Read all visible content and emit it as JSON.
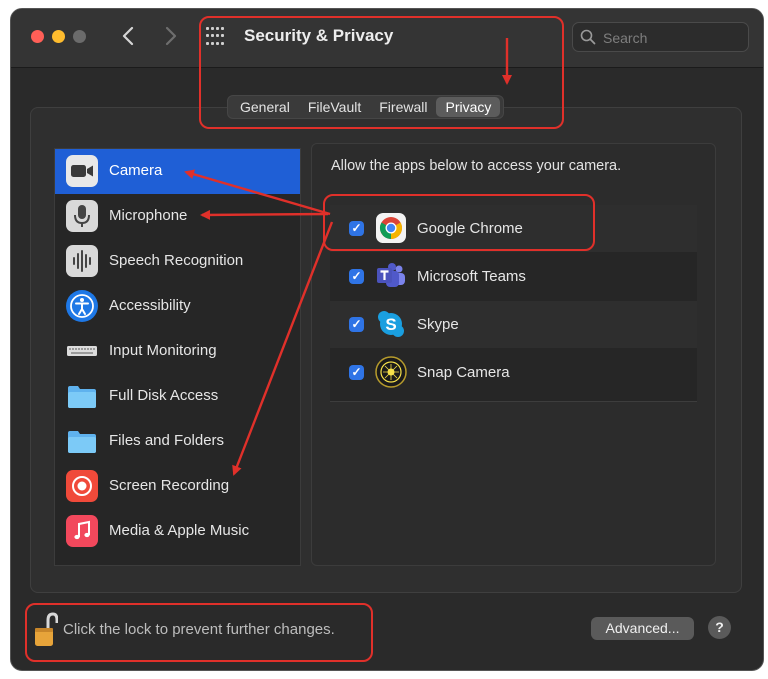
{
  "window": {
    "title": "Security & Privacy",
    "search": {
      "placeholder": "Search",
      "value": ""
    }
  },
  "tabs": [
    {
      "label": "General",
      "selected": false
    },
    {
      "label": "FileVault",
      "selected": false
    },
    {
      "label": "Firewall",
      "selected": false
    },
    {
      "label": "Privacy",
      "selected": true
    }
  ],
  "sidebar": {
    "items": [
      {
        "label": "Camera",
        "icon": "camera-icon",
        "selected": true
      },
      {
        "label": "Microphone",
        "icon": "microphone-icon",
        "selected": false
      },
      {
        "label": "Speech Recognition",
        "icon": "waveform-icon",
        "selected": false
      },
      {
        "label": "Accessibility",
        "icon": "accessibility-icon",
        "selected": false
      },
      {
        "label": "Input Monitoring",
        "icon": "keyboard-icon",
        "selected": false
      },
      {
        "label": "Full Disk Access",
        "icon": "folder-icon",
        "selected": false
      },
      {
        "label": "Files and Folders",
        "icon": "folder-icon",
        "selected": false
      },
      {
        "label": "Screen Recording",
        "icon": "record-icon",
        "selected": false
      },
      {
        "label": "Media & Apple Music",
        "icon": "music-note-icon",
        "selected": false
      }
    ]
  },
  "detail": {
    "description": "Allow the apps below to access your camera.",
    "apps": [
      {
        "name": "Google Chrome",
        "checked": true,
        "icon": "chrome-icon"
      },
      {
        "name": "Microsoft Teams",
        "checked": true,
        "icon": "teams-icon"
      },
      {
        "name": "Skype",
        "checked": true,
        "icon": "skype-icon"
      },
      {
        "name": "Snap Camera",
        "checked": true,
        "icon": "snap-camera-icon"
      }
    ]
  },
  "footer": {
    "lock_text": "Click the lock to prevent further changes.",
    "advanced_label": "Advanced...",
    "help_label": "?"
  },
  "colors": {
    "window_bg": "#2a2a2a",
    "selection": "#1f5fd6",
    "checkbox": "#2f74e6",
    "annotation": "#e0302a"
  }
}
